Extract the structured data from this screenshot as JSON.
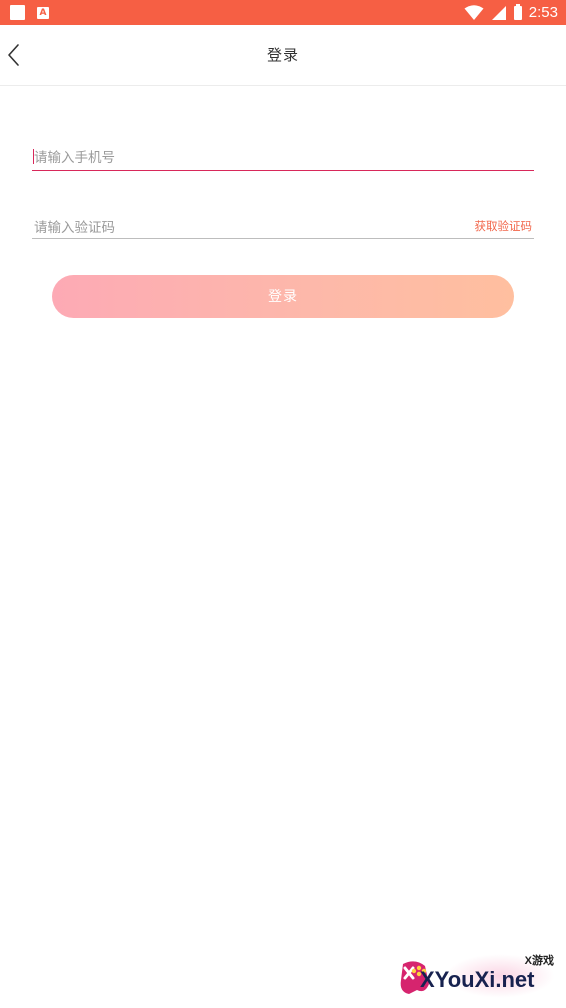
{
  "status_bar": {
    "time": "2:53",
    "notification_icon": "a-icon",
    "background_color": "#f65f44"
  },
  "nav": {
    "title": "登录",
    "back_icon": "chevron-left-icon"
  },
  "form": {
    "phone_placeholder": "请输入手机号",
    "code_placeholder": "请输入验证码",
    "get_code_label": "获取验证码",
    "login_label": "登录"
  },
  "colors": {
    "accent": "#f2664a",
    "input_active_line": "#d8285a",
    "button_gradient_start": "#fdaab5",
    "button_gradient_end": "#ffbf9f"
  },
  "watermark": {
    "small_text": "X游戏",
    "brand_text": "XYouXi.net"
  }
}
